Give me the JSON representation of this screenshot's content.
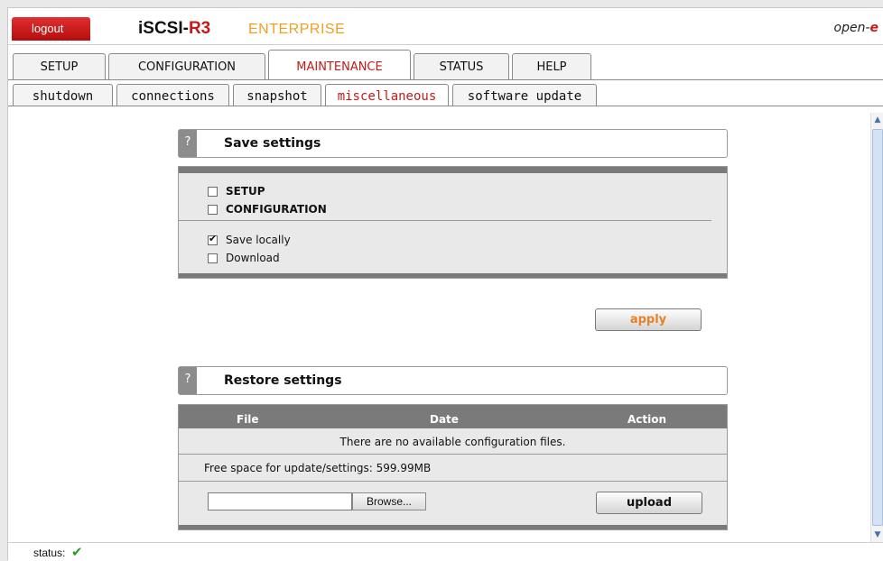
{
  "header": {
    "logout_label": "logout",
    "brand_part1": "iSCSI-",
    "brand_part2": "R3",
    "edition": "ENTERPRISE",
    "corner_brand_prefix": "open-",
    "corner_brand_suffix": "e"
  },
  "main_tabs": [
    {
      "label": "SETUP",
      "active": false
    },
    {
      "label": "CONFIGURATION",
      "active": false
    },
    {
      "label": "MAINTENANCE",
      "active": true
    },
    {
      "label": "STATUS",
      "active": false
    },
    {
      "label": "HELP",
      "active": false
    }
  ],
  "sub_tabs": [
    {
      "label": "shutdown",
      "active": false
    },
    {
      "label": "connections",
      "active": false
    },
    {
      "label": "snapshot",
      "active": false
    },
    {
      "label": "miscellaneous",
      "active": true
    },
    {
      "label": "software update",
      "active": false
    }
  ],
  "save_settings": {
    "help_label": "?",
    "title": "Save settings",
    "options": [
      {
        "label": "SETUP",
        "checked": false,
        "bold": true
      },
      {
        "label": "CONFIGURATION",
        "checked": false,
        "bold": true
      }
    ],
    "targets": [
      {
        "label": "Save locally",
        "checked": true
      },
      {
        "label": "Download",
        "checked": false
      }
    ],
    "apply_label": "apply"
  },
  "restore_settings": {
    "help_label": "?",
    "title": "Restore settings",
    "columns": [
      "File",
      "Date",
      "Action"
    ],
    "empty_message": "There are no available configuration files.",
    "free_space": "Free space for update/settings: 599.99MB",
    "file_value": "",
    "browse_label": "Browse...",
    "upload_label": "upload"
  },
  "status_bar": {
    "label": "status:",
    "icon": "checkmark-icon",
    "icon_glyph": "✔",
    "icon_color": "#2e9a2e"
  },
  "colors": {
    "accent_red": "#c41a1a",
    "edition_orange": "#f0a020",
    "apply_orange": "#e8802a"
  }
}
